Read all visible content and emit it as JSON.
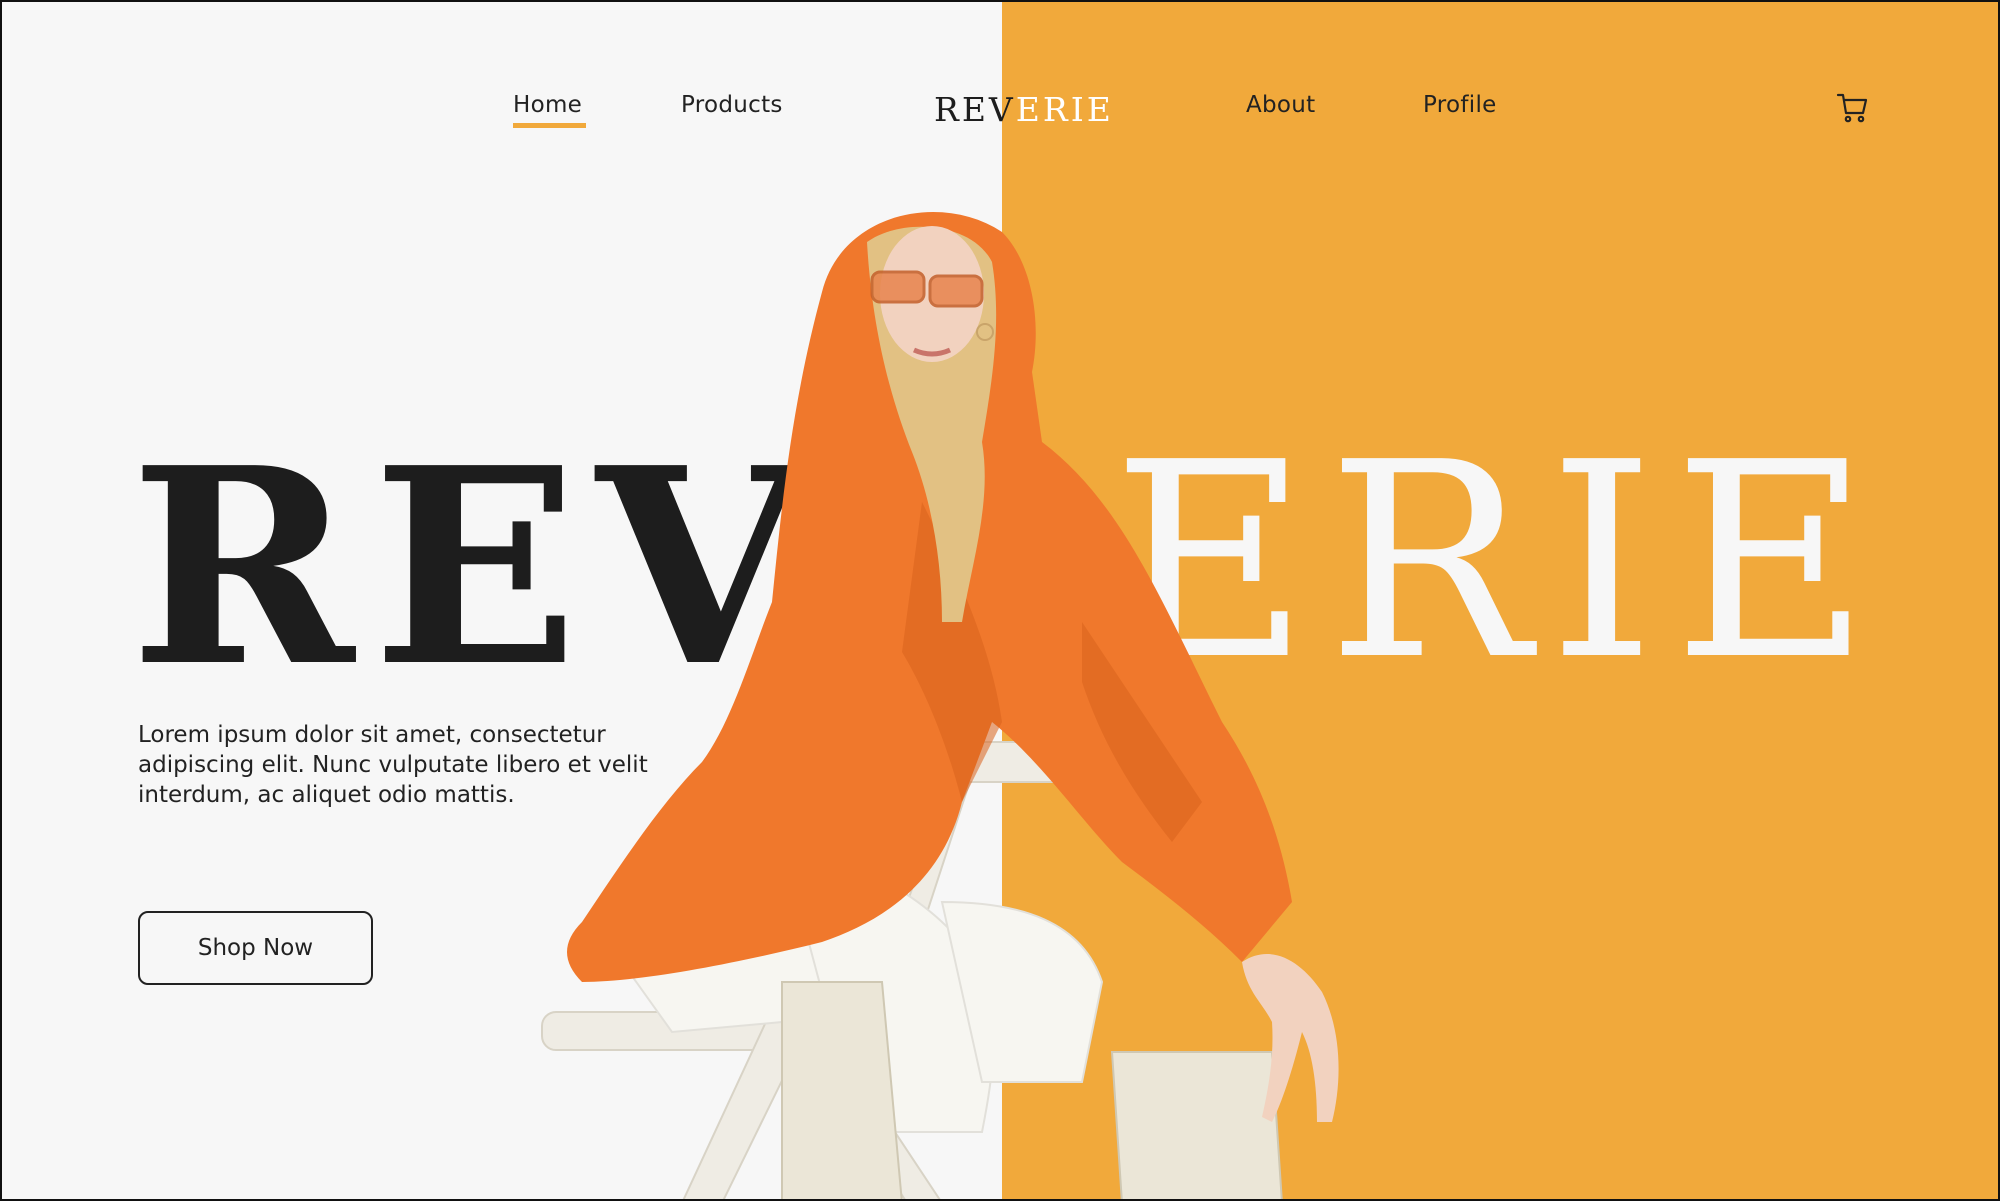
{
  "nav": {
    "home": "Home",
    "products": "Products",
    "about": "About",
    "profile": "Profile",
    "active": "Home"
  },
  "logo": {
    "left_part": "REV",
    "right_part": "ERIE"
  },
  "hero": {
    "title_left": "REV",
    "title_right": "ERIE",
    "description": "Lorem ipsum dolor sit amet, consectetur adipiscing elit. Nunc vulputate libero et velit interdum, ac aliquet odio mattis.",
    "cta_label": "Shop Now"
  },
  "icons": {
    "cart": "cart-icon"
  },
  "colors": {
    "accent": "#f1a93b",
    "background_light": "#f7f7f7",
    "text_dark": "#1d1d1d",
    "hoodie": "#f0782c"
  }
}
